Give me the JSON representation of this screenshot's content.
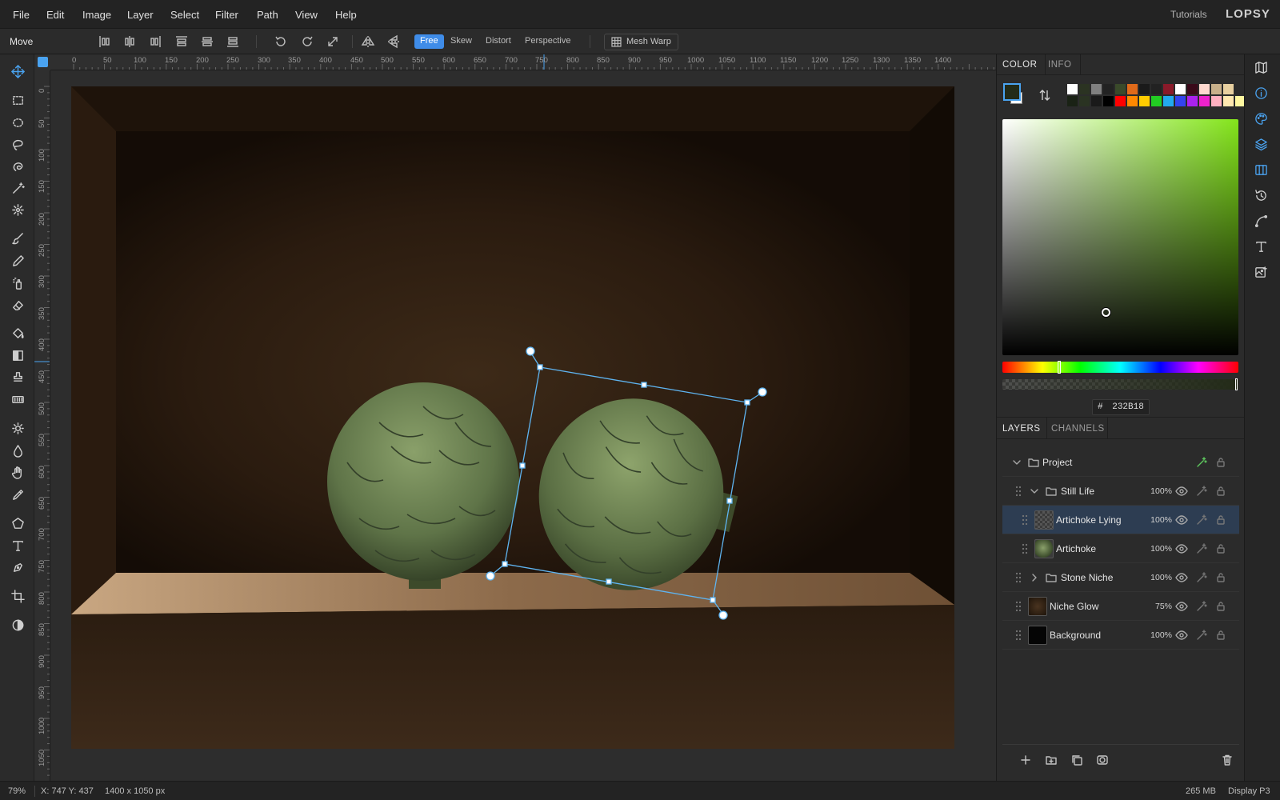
{
  "menubar": {
    "items": [
      "File",
      "Edit",
      "Image",
      "Layer",
      "Select",
      "Filter",
      "Path",
      "View",
      "Help"
    ],
    "tutorials": "Tutorials",
    "logo": "LOPSY"
  },
  "optionsbar": {
    "tool_name": "Move",
    "transform_modes": [
      "Free",
      "Skew",
      "Distort",
      "Perspective"
    ],
    "active_mode": "Free",
    "mesh_warp": "Mesh Warp"
  },
  "rulers": {
    "top_labels": [
      "0",
      "50",
      "100",
      "150",
      "200",
      "250",
      "300",
      "350",
      "400",
      "450",
      "500",
      "550",
      "600",
      "650",
      "700",
      "750",
      "800",
      "850",
      "900",
      "950",
      "1000",
      "1050",
      "1100",
      "1150",
      "1200",
      "1250",
      "1300",
      "1350",
      "1400"
    ],
    "left_labels": [
      "0",
      "50",
      "100",
      "150",
      "200",
      "250",
      "300",
      "350",
      "400",
      "450",
      "500",
      "550",
      "600",
      "650",
      "700",
      "750",
      "800",
      "850",
      "900",
      "950",
      "1000",
      "1050"
    ]
  },
  "color_panel": {
    "tabs": [
      "COLOR",
      "INFO"
    ],
    "active_tab": "COLOR",
    "foreground": "#232B18",
    "hex_prefix": "#",
    "hex_value": "232B18",
    "swatches_row1": [
      "#ffffff",
      "#2b3322",
      "#808080",
      "#222222",
      "#3a4a2a",
      "#e06a1a",
      "#1a1a1a",
      "#222222",
      "#8a1a2a",
      "#ffffff",
      "#3a0a1a",
      "#ffd9cf",
      "#c8b08a",
      "#e8d0a0"
    ],
    "swatches_row2": [
      "#1a2215",
      "#2a3322",
      "#1a1a1a",
      "#000000",
      "#ff0000",
      "#ff8800",
      "#ffcc00",
      "#22cc22",
      "#22aaee",
      "#3344ee",
      "#aa22ee",
      "#ee22cc",
      "#ffb0c0",
      "#ffe8b0",
      "#fff8a0"
    ]
  },
  "layers_panel": {
    "tabs": [
      "LAYERS",
      "CHANNELS"
    ],
    "active_tab": "LAYERS",
    "layers": [
      {
        "name": "Project",
        "opacity": "",
        "type": "group",
        "expanded": true,
        "indent": 0
      },
      {
        "name": "Still Life",
        "opacity": "100%",
        "type": "group",
        "expanded": true,
        "indent": 1
      },
      {
        "name": "Artichoke Lying",
        "opacity": "100%",
        "type": "layer",
        "indent": 2,
        "selected": true
      },
      {
        "name": "Artichoke",
        "opacity": "100%",
        "type": "layer",
        "indent": 2
      },
      {
        "name": "Stone Niche",
        "opacity": "100%",
        "type": "group",
        "expanded": false,
        "indent": 1
      },
      {
        "name": "Niche Glow",
        "opacity": "75%",
        "type": "layer",
        "indent": 1
      },
      {
        "name": "Background",
        "opacity": "100%",
        "type": "layer",
        "indent": 1
      }
    ]
  },
  "statusbar": {
    "zoom": "79%",
    "cursor": "X: 747 Y: 437",
    "doc_size": "1400 x 1050 px",
    "memory": "265 MB",
    "color_profile": "Display P3"
  },
  "colors": {
    "accent": "#4aa3f0",
    "selected_layer_bg": "#2d3d52",
    "transform_box": "#5fb4f0"
  }
}
